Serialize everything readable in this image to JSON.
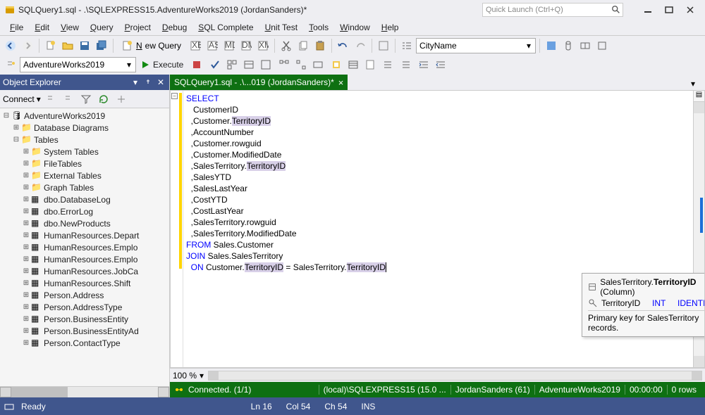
{
  "window": {
    "title": "SQLQuery1.sql - .\\SQLEXPRESS15.AdventureWorks2019 (JordanSanders)*",
    "quicklaunch_placeholder": "Quick Launch (Ctrl+Q)"
  },
  "menu": [
    "File",
    "Edit",
    "View",
    "Query",
    "Project",
    "Debug",
    "SQL Complete",
    "Unit Test",
    "Tools",
    "Window",
    "Help"
  ],
  "toolbar": {
    "new_query": "New Query",
    "combo": "CityName",
    "db_combo": "AdventureWorks2019",
    "execute": "Execute"
  },
  "objexp": {
    "title": "Object Explorer",
    "connect": "Connect",
    "root": "AdventureWorks2019",
    "folders": [
      "Database Diagrams",
      "Tables"
    ],
    "tablesubs": [
      "System Tables",
      "FileTables",
      "External Tables",
      "Graph Tables"
    ],
    "tables": [
      "dbo.DatabaseLog",
      "dbo.ErrorLog",
      "dbo.NewProducts",
      "HumanResources.Depart",
      "HumanResources.Emplo",
      "HumanResources.Emplo",
      "HumanResources.JobCa",
      "HumanResources.Shift",
      "Person.Address",
      "Person.AddressType",
      "Person.BusinessEntity",
      "Person.BusinessEntityAd",
      "Person.ContactType"
    ]
  },
  "tab": {
    "label": "SQLQuery1.sql - .\\...019 (JordanSanders)*"
  },
  "code": {
    "lines": [
      {
        "t": "SELECT",
        "cls": "kw"
      },
      {
        "t": "   CustomerID"
      },
      {
        "t": "  ,Customer.",
        "hl": "TerritoryID"
      },
      {
        "t": "  ,AccountNumber"
      },
      {
        "t": "  ,Customer.rowguid"
      },
      {
        "t": "  ,Customer.ModifiedDate"
      },
      {
        "t": "  ,SalesTerritory.",
        "hl": "TerritoryID"
      },
      {
        "t": "  ,SalesYTD"
      },
      {
        "t": "  ,SalesLastYear"
      },
      {
        "t": "  ,CostYTD"
      },
      {
        "t": "  ,CostLastYear"
      },
      {
        "t": "  ,SalesTerritory.rowguid"
      },
      {
        "t": "  ,SalesTerritory.ModifiedDate"
      },
      {
        "pre": "FROM",
        "t": " Sales.Customer"
      },
      {
        "pre": "JOIN",
        "t": " Sales.SalesTerritory"
      },
      {
        "pre": "  ON",
        "t": " Customer.",
        "hl1": "TerritoryID",
        "mid": " = SalesTerritory.",
        "hl2": "TerritoryID"
      }
    ]
  },
  "tooltip": {
    "l1a": "SalesTerritory.",
    "l1b": "TerritoryID",
    "l1c": " (Column)",
    "l2a": "TerritoryID",
    "l2b": "INT",
    "l2c": "IDENTITY",
    "l3": "Primary key for SalesTerritory records."
  },
  "zoom": "100 %",
  "status": {
    "connected": "Connected. (1/1)",
    "server": "(local)\\SQLEXPRESS15 (15.0 ...",
    "user": "JordanSanders (61)",
    "db": "AdventureWorks2019",
    "time": "00:00:00",
    "rows": "0 rows"
  },
  "bottom": {
    "ready": "Ready",
    "ln": "Ln 16",
    "col": "Col 54",
    "ch": "Ch 54",
    "ins": "INS"
  }
}
